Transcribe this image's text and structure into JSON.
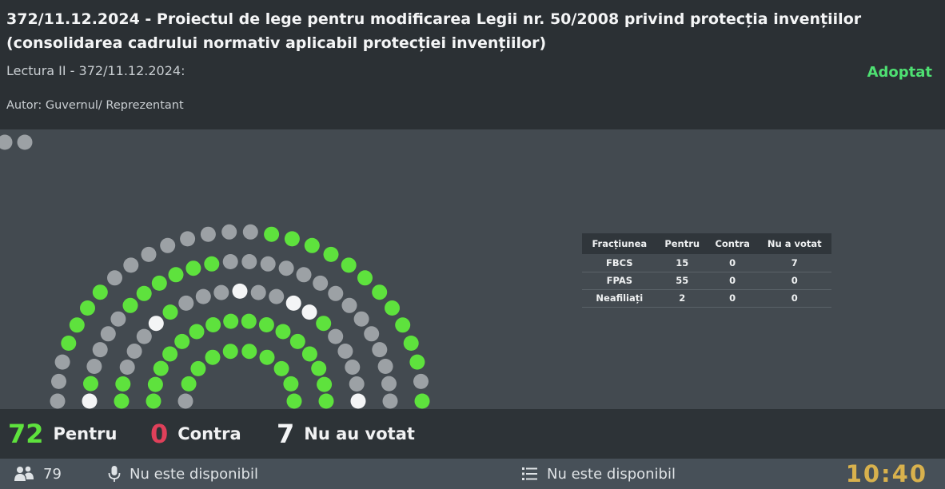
{
  "header": {
    "title": "372/11.12.2024 - Proiectul de lege pentru modificarea Legii nr. 50/2008 privind protecția invențiilor (consolidarea cadrului normativ aplicabil protecției invențiilor)",
    "reading": "Lectura II - 372/11.12.2024:",
    "status": "Adoptat",
    "author": "Autor: Guvernul/ Reprezentant"
  },
  "colors": {
    "for": "#5ee23d",
    "against": "#e0405a",
    "absent": "#9ca1a5",
    "present_seat": "#f4f5f6",
    "status": "#4ee072",
    "clock": "#d8b14d"
  },
  "factions": {
    "headers": [
      "Fracțiunea",
      "Pentru",
      "Contra",
      "Nu a votat"
    ],
    "rows": [
      [
        "FBCS",
        "15",
        "0",
        "7"
      ],
      [
        "FPAS",
        "55",
        "0",
        "0"
      ],
      [
        "Neafiliați",
        "2",
        "0",
        "0"
      ]
    ]
  },
  "summary": {
    "for_count": "72",
    "for_label": "Pentru",
    "against_count": "0",
    "against_label": "Contra",
    "novote_count": "7",
    "novote_label": "Nu au votat"
  },
  "footer": {
    "attendance_icon": "people-icon",
    "attendance": "79",
    "speaker_icon": "microphone-icon",
    "speaker": "Nu este disponibil",
    "agenda_icon": "list-icon",
    "agenda": "Nu este disponibil",
    "clock": "10:40"
  },
  "hemicycle": {
    "seats_total": 101,
    "pattern": "gg+ggggggggggggggggggggggggggg---wg---w--wwg----wwg----gggggg-----------------gggg--------ggggggggggg-ggggggwgg--gg-ggg-gg-ggggg-ggwgggg",
    "legend": {
      "g": "for",
      "-": "absent",
      "w": "present_seat",
      "+": "absent"
    }
  }
}
